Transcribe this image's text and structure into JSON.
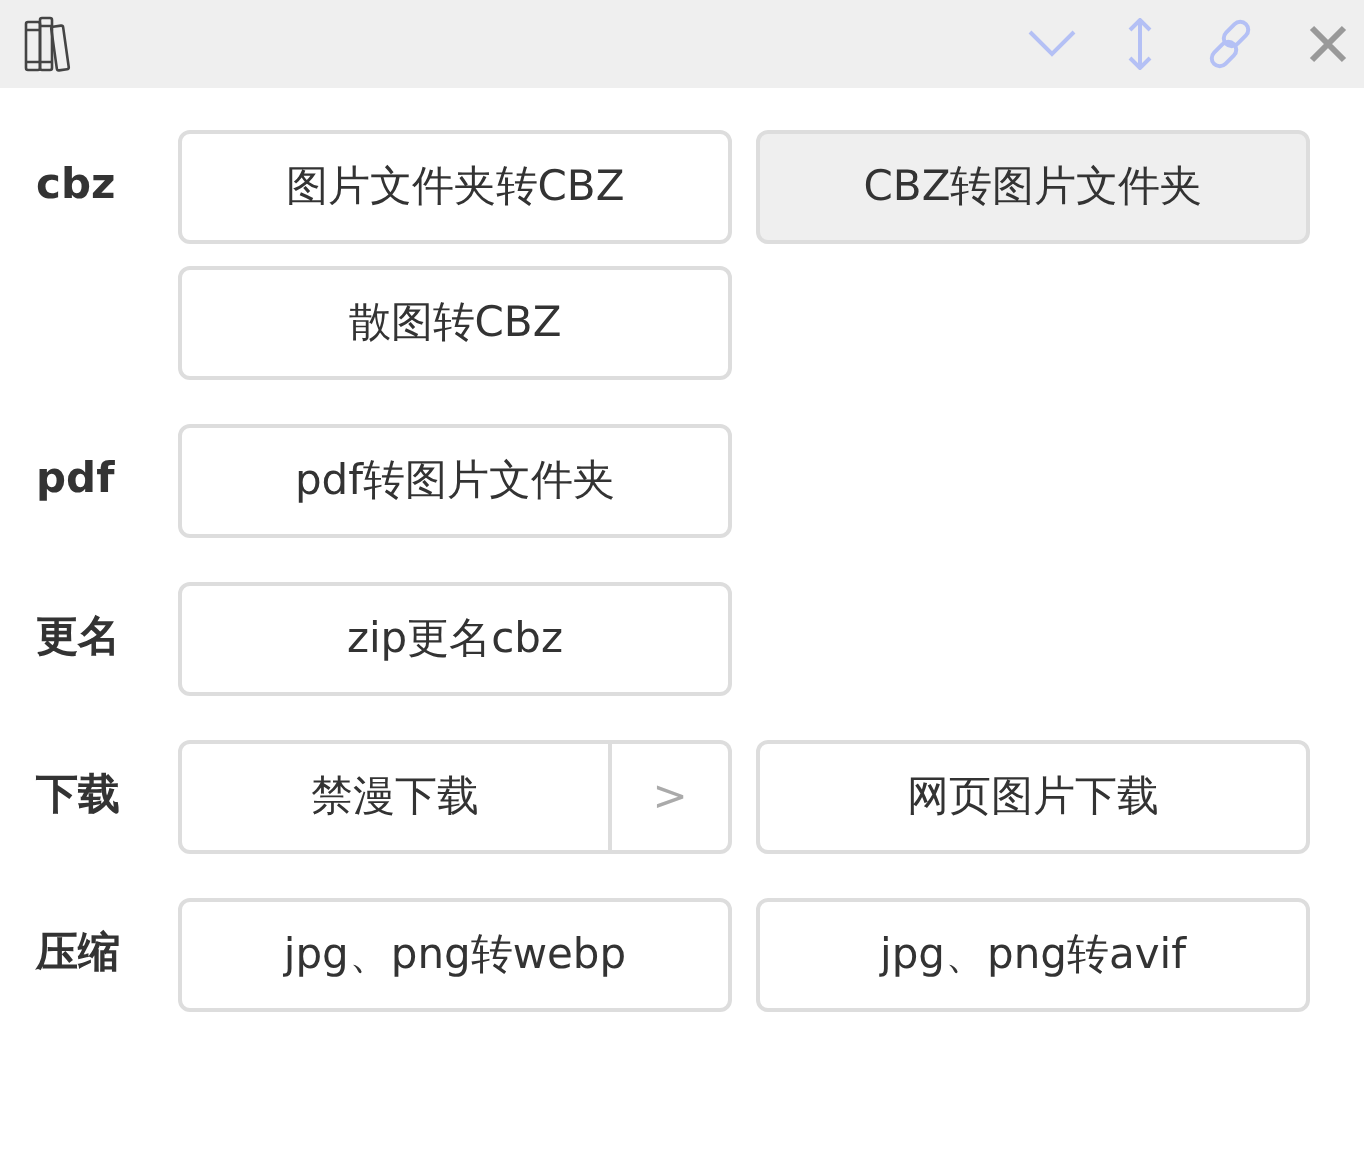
{
  "sections": [
    {
      "label": "cbz",
      "buttons": [
        {
          "text": "图片文件夹转CBZ",
          "kind": "plain",
          "selected": false
        },
        {
          "text": "CBZ转图片文件夹",
          "kind": "plain",
          "selected": true
        },
        {
          "text": "散图转CBZ",
          "kind": "plain",
          "selected": false
        }
      ]
    },
    {
      "label": "pdf",
      "buttons": [
        {
          "text": "pdf转图片文件夹",
          "kind": "plain",
          "selected": false
        }
      ]
    },
    {
      "label": "更名",
      "buttons": [
        {
          "text": "zip更名cbz",
          "kind": "plain",
          "selected": false
        }
      ]
    },
    {
      "label": "下载",
      "buttons": [
        {
          "text": "禁漫下载",
          "kind": "split",
          "arrow": ">",
          "selected": false
        },
        {
          "text": "网页图片下载",
          "kind": "plain",
          "selected": false
        }
      ]
    },
    {
      "label": "压缩",
      "buttons": [
        {
          "text": "jpg、png转webp",
          "kind": "plain",
          "selected": false
        },
        {
          "text": "jpg、png转avif",
          "kind": "plain",
          "selected": false
        }
      ]
    }
  ]
}
